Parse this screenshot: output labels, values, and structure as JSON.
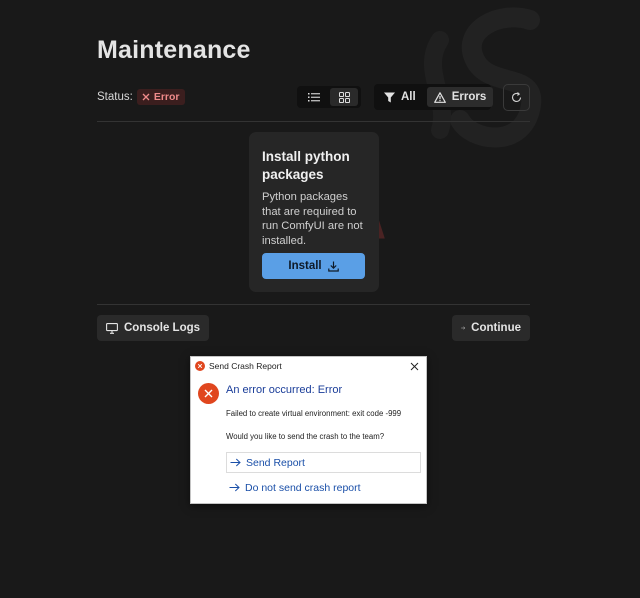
{
  "page": {
    "title": "Maintenance"
  },
  "status": {
    "label": "Status:",
    "badge": "Error"
  },
  "filters": {
    "all_label": "All",
    "errors_label": "Errors"
  },
  "task_card": {
    "title": "Install python packages",
    "description": "Python packages that are required to run ComfyUI are not installed.",
    "button_label": "Install"
  },
  "footer": {
    "console_logs_label": "Console Logs",
    "continue_label": "Continue"
  },
  "dialog": {
    "title": "Send Crash Report",
    "heading": "An error occurred: Error",
    "message": "Failed to create virtual environment: exit code -999",
    "question": "Would you like to send the crash to the team?",
    "send_label": "Send Report",
    "dont_send_label": "Do not send crash report"
  },
  "colors": {
    "background": "#191919",
    "accent": "#5a9fe6",
    "error_badge_bg": "#3b1e1e",
    "error_badge_text": "#f08a8a",
    "dialog_link": "#1a4fa8",
    "dialog_error_icon": "#e0461e"
  },
  "icons": {
    "status_badge": "x-icon",
    "view_list": "list-icon",
    "view_grid": "grid-icon",
    "filter_all": "filter-icon",
    "filter_errors": "warning-icon",
    "refresh": "refresh-icon",
    "install": "download-icon",
    "console_logs": "monitor-icon",
    "continue": "arrow-right-icon",
    "dialog_error": "error-circle-icon"
  }
}
